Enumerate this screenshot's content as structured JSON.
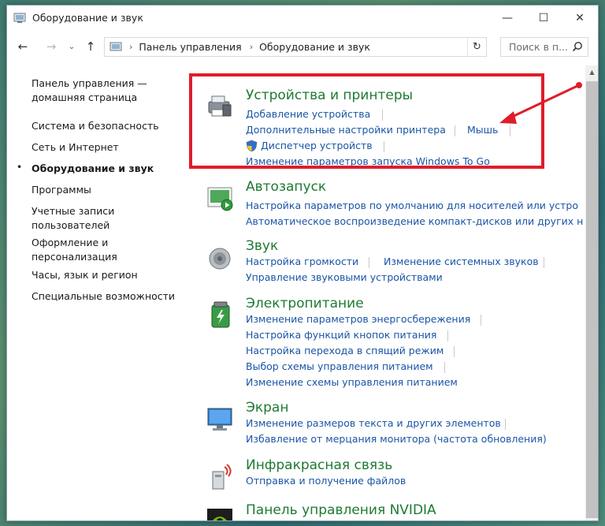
{
  "window": {
    "title": "Оборудование и звук",
    "minimize": "—",
    "maximize": "☐",
    "close": "✕"
  },
  "nav": {
    "back": "←",
    "forward": "→",
    "history": "⌄",
    "up": "↑",
    "breadcrumb": [
      "Панель управления",
      "Оборудование и звук"
    ],
    "separator": "›",
    "refresh": "↻",
    "search_placeholder": "Поиск в п..."
  },
  "sidebar": {
    "items": [
      {
        "label": "Панель управления — домашняя страница"
      },
      {
        "label": "Система и безопасность"
      },
      {
        "label": "Сеть и Интернет"
      },
      {
        "label": "Оборудование и звук",
        "active": true
      },
      {
        "label": "Программы"
      },
      {
        "label": "Учетные записи пользователей"
      },
      {
        "label": "Оформление и персонализация"
      },
      {
        "label": "Часы, язык и регион"
      },
      {
        "label": "Специальные возможности"
      }
    ],
    "bullet": "•"
  },
  "categories": {
    "devices": {
      "title": "Устройства и принтеры",
      "links": [
        "Добавление устройства",
        "Дополнительные настройки принтера",
        "Мышь",
        "Диспетчер устройств",
        "Изменение параметров запуска Windows To Go"
      ],
      "icon": "printer-icon"
    },
    "autoplay": {
      "title": "Автозапуск",
      "links": [
        "Настройка параметров по умолчанию для носителей или устро",
        "Автоматическое воспроизведение компакт-дисков или других н"
      ],
      "icon": "autoplay-icon"
    },
    "sound": {
      "title": "Звук",
      "links": [
        "Настройка громкости",
        "Изменение системных звуков",
        "Управление звуковыми устройствами"
      ],
      "icon": "speaker-icon"
    },
    "power": {
      "title": "Электропитание",
      "links": [
        "Изменение параметров энергосбережения",
        "Настройка функций кнопок питания",
        "Настройка перехода в спящий режим",
        "Выбор схемы управления питанием",
        "Изменение схемы управления питанием"
      ],
      "icon": "battery-icon"
    },
    "display": {
      "title": "Экран",
      "links": [
        "Изменение размеров текста и других элементов",
        "Избавление от мерцания монитора (частота обновления)"
      ],
      "icon": "monitor-icon"
    },
    "infrared": {
      "title": "Инфракрасная связь",
      "links": [
        "Отправка и получение файлов"
      ],
      "icon": "infrared-icon"
    },
    "nvidia": {
      "title": "Панель управления NVIDIA",
      "icon": "nvidia-icon"
    }
  },
  "colors": {
    "link": "#1a55a6",
    "category_title": "#1e7a32",
    "highlight": "#e01d2a"
  }
}
